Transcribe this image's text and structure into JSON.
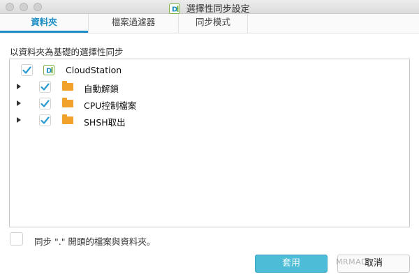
{
  "window": {
    "title": "選擇性同步設定",
    "app_icon_letter": "D"
  },
  "tabs": [
    {
      "label": "資料夾",
      "active": true
    },
    {
      "label": "檔案過濾器",
      "active": false
    },
    {
      "label": "同步模式",
      "active": false
    }
  ],
  "section_label": "以資料夾為基礎的選擇性同步",
  "tree": {
    "root": {
      "label": "CloudStation",
      "checked": true,
      "icon": "cloudstation-icon"
    },
    "children": [
      {
        "label": "自動解鎖",
        "checked": true,
        "expandable": true,
        "icon": "folder-icon"
      },
      {
        "label": "CPU控制檔案",
        "checked": true,
        "expandable": true,
        "icon": "folder-icon"
      },
      {
        "label": "SHSH取出",
        "checked": true,
        "expandable": true,
        "icon": "folder-icon"
      }
    ]
  },
  "sync_dot_files": {
    "label": "同步 \".\" 開頭的檔案與資料夾。",
    "checked": false
  },
  "buttons": {
    "apply": "套用",
    "cancel": "取消"
  },
  "watermark": "MRMAD.CO",
  "colors": {
    "accent": "#1d8ec6",
    "checkmark": "#2a9bd0",
    "folder": "#f0a22b",
    "apply_button": "#4dbcd7"
  }
}
